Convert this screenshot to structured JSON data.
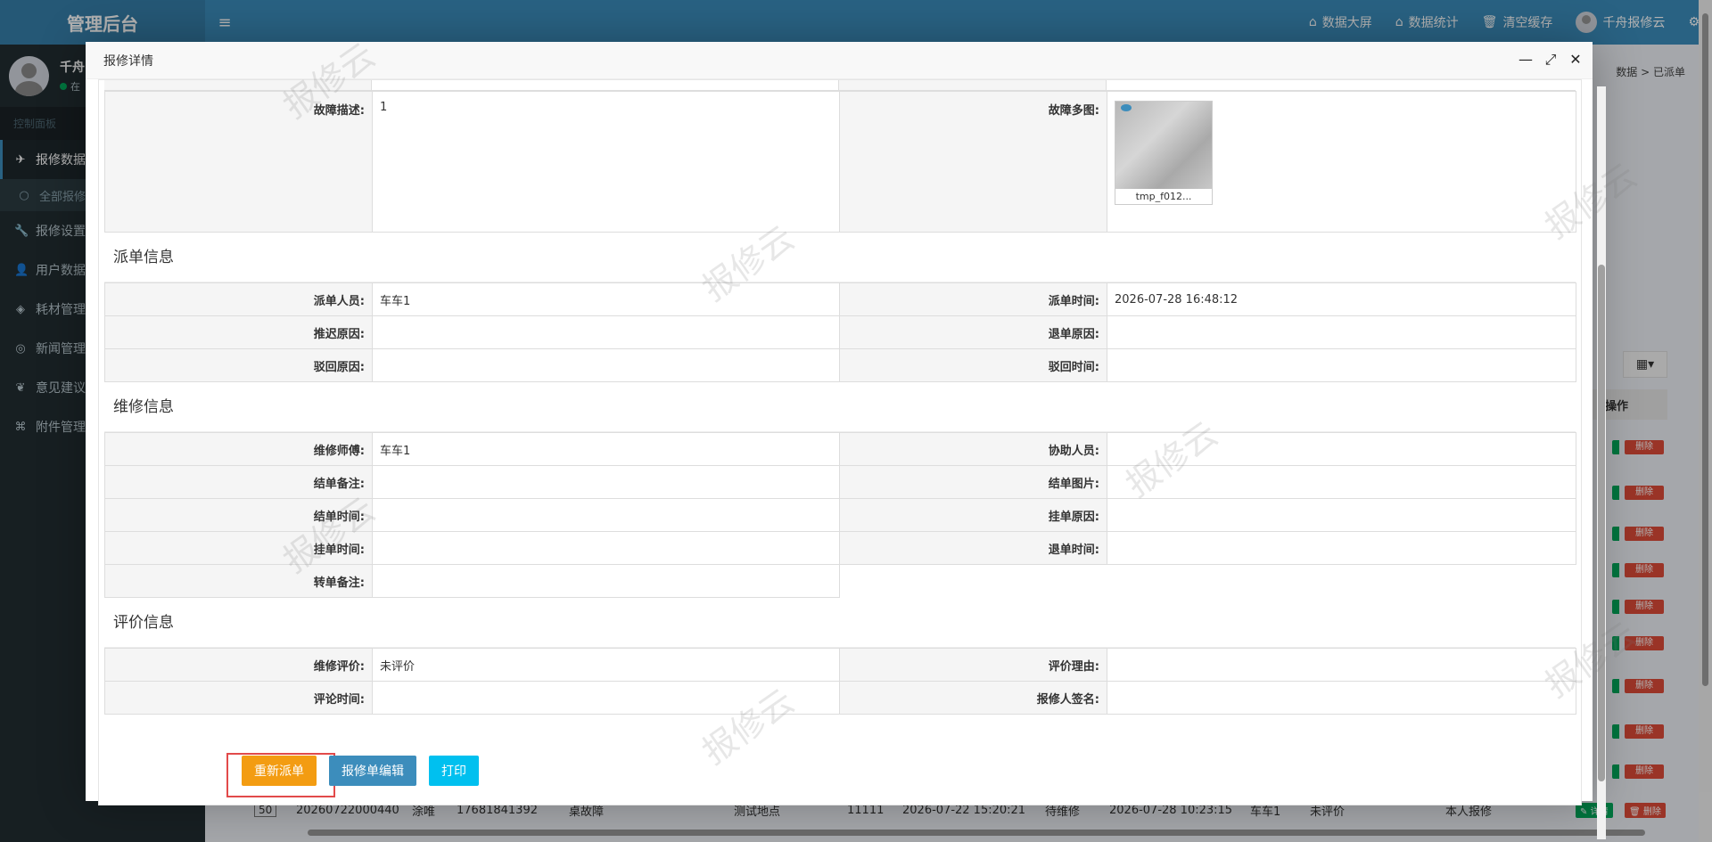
{
  "header": {
    "brand": "管理后台",
    "links": [
      "数据大屏",
      "数据统计",
      "清空缓存"
    ],
    "user": "千舟报修云"
  },
  "sidebar": {
    "user_name": "千舟",
    "user_status": "在",
    "section": "控制面板",
    "items": [
      {
        "label": "报修数据",
        "icon": "paper-plane-icon"
      },
      {
        "label": "全部报修",
        "icon": "circle-icon"
      },
      {
        "label": "报修设置",
        "icon": "wrench-icon"
      },
      {
        "label": "用户数据",
        "icon": "user-icon"
      },
      {
        "label": "耗材管理",
        "icon": "cube-icon"
      },
      {
        "label": "新闻管理",
        "icon": "rss-icon"
      },
      {
        "label": "意见建议",
        "icon": "leaf-icon"
      },
      {
        "label": "附件管理",
        "icon": "tags-icon"
      }
    ]
  },
  "breadcrumb": [
    "数据",
    "已派单"
  ],
  "background_table": {
    "op_header": "操作",
    "delete_label": "删除",
    "detail_label": "详情",
    "row": {
      "page_size": "50",
      "order_no": "20260722000440",
      "name": "涂唯",
      "phone": "17681841392",
      "fault": "桌故障",
      "location": "测试地点",
      "code": "11111",
      "created": "2026-07-22 15:20:21",
      "status": "待维修",
      "dispatched": "2026-07-28 10:23:15",
      "worker": "车车1",
      "rating": "未评价",
      "source": "本人报修"
    }
  },
  "modal": {
    "title": "报修详情",
    "fault": {
      "desc_label": "故障描述:",
      "desc_value": "1",
      "images_label": "故障多图:",
      "image_caption": "tmp_f012..."
    },
    "dispatch": {
      "title": "派单信息",
      "rows": [
        [
          "派单人员:",
          "车车1",
          "派单时间:",
          "2026-07-28 16:48:12"
        ],
        [
          "推迟原因:",
          "",
          "退单原因:",
          ""
        ],
        [
          "驳回原因:",
          "",
          "驳回时间:",
          ""
        ]
      ]
    },
    "repair": {
      "title": "维修信息",
      "rows": [
        [
          "维修师傅:",
          "车车1",
          "协助人员:",
          ""
        ],
        [
          "结单备注:",
          "",
          "结单图片:",
          ""
        ],
        [
          "结单时间:",
          "",
          "挂单原因:",
          ""
        ],
        [
          "挂单时间:",
          "",
          "退单时间:",
          ""
        ],
        [
          "转单备注:",
          ""
        ]
      ]
    },
    "evaluation": {
      "title": "评价信息",
      "rows": [
        [
          "维修评价:",
          "未评价",
          "评价理由:",
          ""
        ],
        [
          "评论时间:",
          "",
          "报修人签名:",
          ""
        ]
      ]
    },
    "buttons": {
      "redispatch": "重新派单",
      "edit": "报修单编辑",
      "print": "打印"
    }
  },
  "watermark": "报修云",
  "colors": {
    "header": "#3c8dbc",
    "sidebar": "#222d32",
    "orange": "#f39c12",
    "blue": "#3c8dbc",
    "cyan": "#00c0ef",
    "highlight": "#e24a4a"
  }
}
